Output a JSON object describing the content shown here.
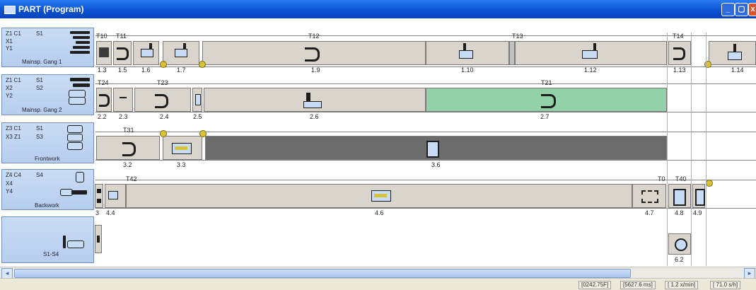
{
  "window": {
    "title": "PART (Program)"
  },
  "channels": [
    {
      "labels": [
        "Z1 C1",
        "S1",
        "X1",
        "Y1"
      ],
      "name": "Mainsp. Gang 1"
    },
    {
      "labels": [
        "Z1 C1",
        "S1",
        "X2",
        "S2",
        "Y2"
      ],
      "name": "Mainsp. Gang 2"
    },
    {
      "labels": [
        "Z3 C1",
        "S1",
        "X3 Z1",
        "S3"
      ],
      "name": "Frontwork"
    },
    {
      "labels": [
        "Z4 C4",
        "S4",
        "X4",
        "Y4"
      ],
      "name": "Backwork"
    },
    {
      "labels": [
        "S1-S4"
      ],
      "name": ""
    }
  ],
  "tools": {
    "row1": [
      "T10",
      "T11",
      "T12",
      "T13",
      "T14"
    ],
    "row2": [
      "T24",
      "T23",
      "T21"
    ],
    "row3": [
      "T31"
    ],
    "row4": [
      "T42",
      "T0",
      "T40"
    ]
  },
  "ops": {
    "row1": [
      "1.3",
      "1.5",
      "1.6",
      "1.7",
      "1.9",
      "1.10",
      "1.12",
      "1.13",
      "1.14"
    ],
    "row2": [
      "2.2",
      "2.3",
      "2.4",
      "2.5",
      "2.6",
      "2.7"
    ],
    "row3": [
      "3.2",
      "3.3",
      "3.6"
    ],
    "row4": [
      "3",
      "4.4",
      "4.6",
      "4.7",
      "4.8",
      "4.9"
    ],
    "row5": [
      "6.2"
    ]
  },
  "status": {
    "cells": [
      "[0242.75F]",
      "[5627.6 ms]",
      "[ 1.2 x/min]",
      "[ 71.0 s/h]"
    ]
  },
  "colors": {
    "titlebar": "#0a4fd0",
    "block": "#d9d4cc",
    "green": "#93d2a8",
    "dark": "#6c6c6c",
    "panel": "#c9dcf5"
  }
}
